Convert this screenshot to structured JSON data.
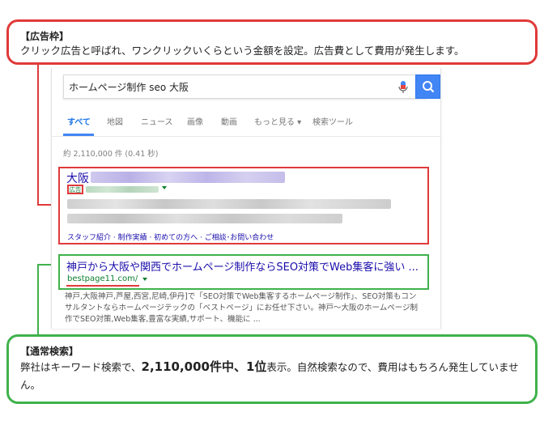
{
  "ad_callout": {
    "title": "【広告枠】",
    "body": "クリック広告と呼ばれ、ワンクリックいくらという金額を設定。広告費として費用が発生します。"
  },
  "search": {
    "query": "ホームページ制作 seo 大阪",
    "tabs": [
      {
        "label": "すべて"
      },
      {
        "label": "地図"
      },
      {
        "label": "ニュース"
      },
      {
        "label": "画像"
      },
      {
        "label": "動画"
      },
      {
        "label": "もっと見る ▾"
      },
      {
        "label": "検索ツール"
      }
    ],
    "stats": "約 2,110,000 件 (0.41 秒)"
  },
  "ad_result": {
    "title": "大阪",
    "badge": "広告",
    "sitelinks": "スタッフ紹介 · 制作実績 · 初めての方へ · ご相談･お問い合わせ"
  },
  "organic_result": {
    "title": "神戸から大阪や関西でホームページ制作ならSEO対策でWeb集客に強い ...",
    "url": "bestpage11.com/",
    "snippet": "神戸,大阪神戸,芦屋,西宮,尼崎,伊丹]で「SEO対策でWeb集客するホームページ制作」、SEO対策もコンサルタントならホームページテックの「ベストページ」にお任せ下さい。神戸～大阪のホームページ制作でSEO対策,Web集客,豊富な実績,サポート、機能に ..."
  },
  "organic_callout": {
    "title": "【通常検索】",
    "body_pre": "弊社はキーワード検索で、",
    "body_strong": "2,110,000件中、1位",
    "body_post": "表示。自然検索なので、費用はもちろん発生していません。"
  },
  "colors": {
    "ad_accent": "#e03a3a",
    "organic_accent": "#3fb24c",
    "link": "#1a0dab",
    "url_green": "#0a7f2e",
    "google_blue": "#4285f4"
  },
  "icons": [
    "mic-icon",
    "search-icon",
    "dropdown-arrow-icon"
  ]
}
